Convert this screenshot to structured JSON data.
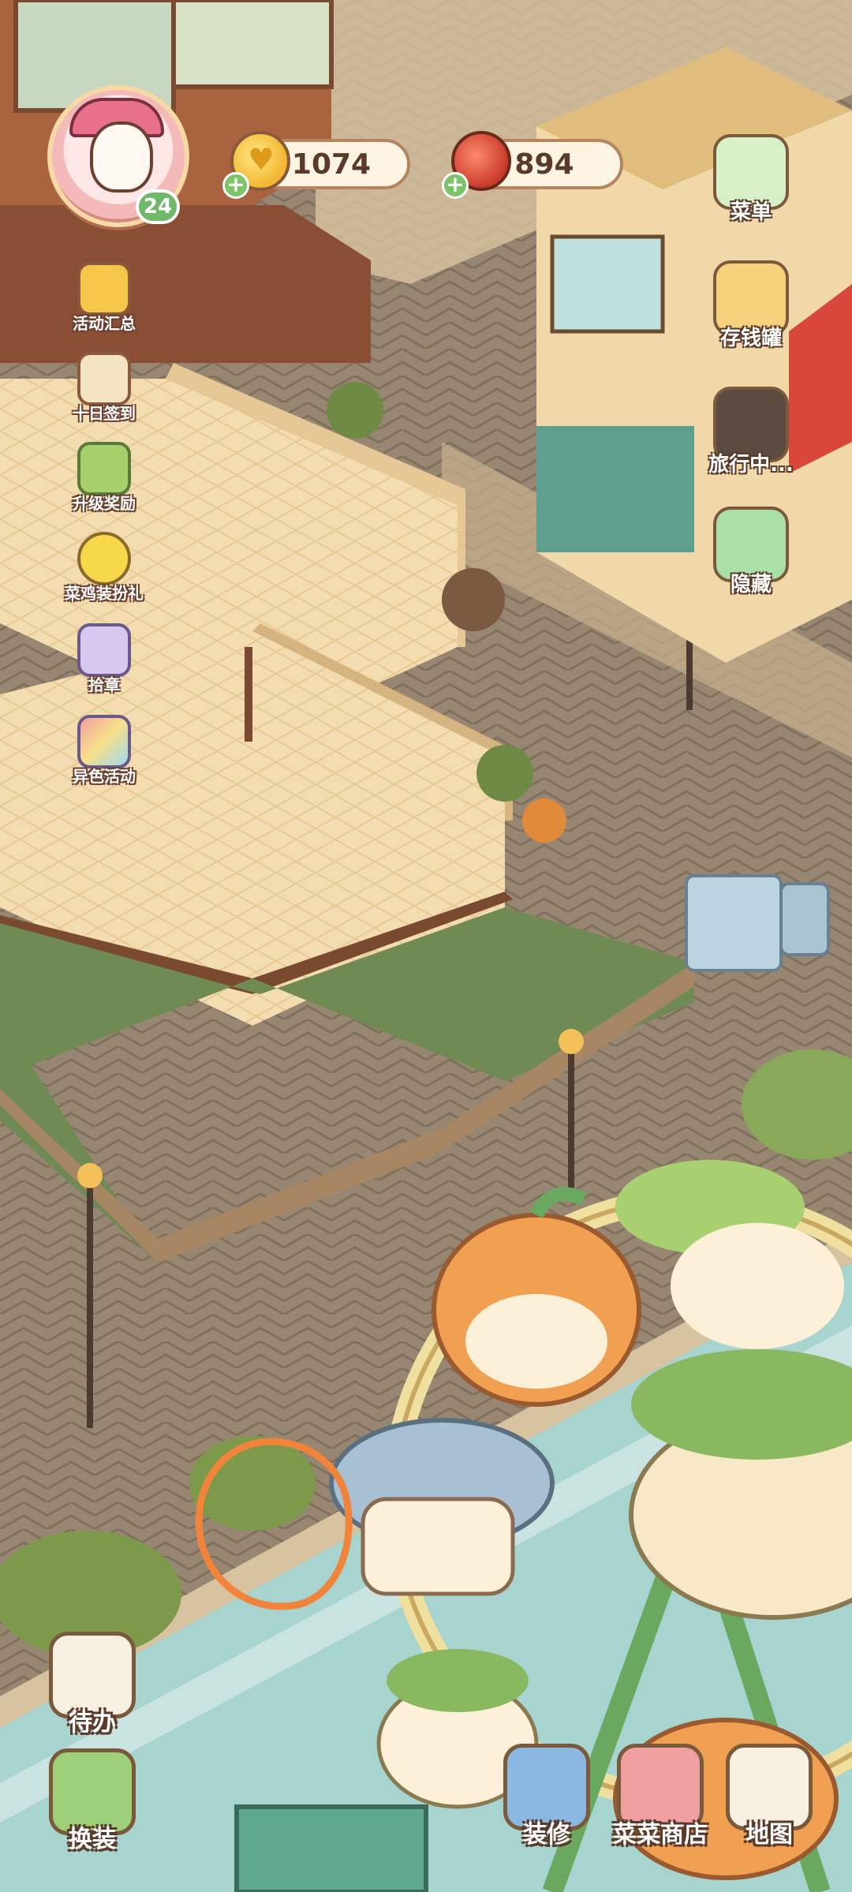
{
  "resources": {
    "coins": "1074",
    "fruit": "894"
  },
  "player": {
    "level": "24"
  },
  "left_menu": [
    {
      "label": "活动汇总",
      "icon": "crown-icon"
    },
    {
      "label": "十日签到",
      "icon": "calendar-pot-icon"
    },
    {
      "label": "升级奖励",
      "icon": "gift-arrow-icon"
    },
    {
      "label": "菜鸡装扮礼",
      "icon": "chick-icon"
    },
    {
      "label": "拾章",
      "icon": "badge-icon"
    },
    {
      "label": "异色活动",
      "icon": "rainbow-icon"
    }
  ],
  "right_menu": [
    {
      "label": "菜单",
      "icon": "menu-list-icon"
    },
    {
      "label": "存钱罐",
      "icon": "piggy-bank-icon"
    },
    {
      "label": "旅行中...",
      "icon": "camera-icon"
    },
    {
      "label": "隐藏",
      "icon": "hide-frame-icon"
    }
  ],
  "bottom_bar": {
    "todo_label": "待办",
    "dress_label": "换装",
    "decorate_label": "装修",
    "shop_label": "菜菜商店",
    "map_label": "地图"
  },
  "colors": {
    "ground": "#8f7f6c",
    "floor": "#f2d9ac",
    "grass": "#6f8a52",
    "river": "#8fc4c4",
    "highlight_circle": "#f0843a"
  }
}
